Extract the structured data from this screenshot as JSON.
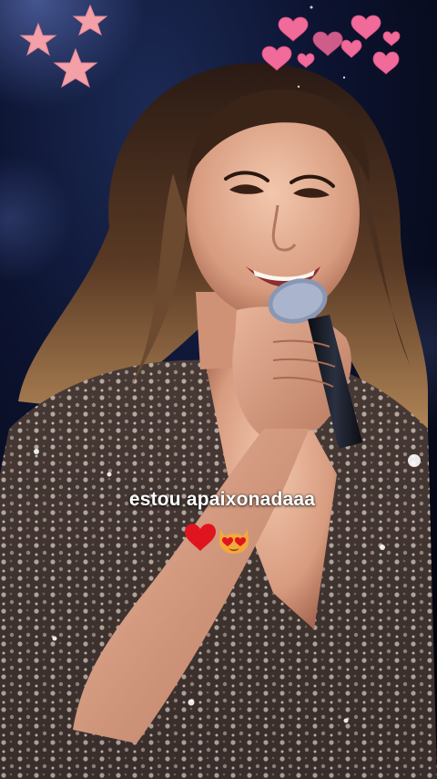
{
  "story": {
    "caption": "estou apaixonadaaa"
  },
  "stickers": {
    "stars_icon": "pink-stars-icon",
    "hearts_icon": "pink-hearts-icon",
    "caption_emojis": [
      "red-heart-icon",
      "heart-eyes-cat-icon"
    ]
  },
  "colors": {
    "star_pink": "#f4a0a8",
    "heart_pink": "#f06a9a",
    "red_heart": "#e0141e",
    "cat_orange": "#f2a93a",
    "dress_base": "#4a3c38",
    "background": "#050814"
  }
}
